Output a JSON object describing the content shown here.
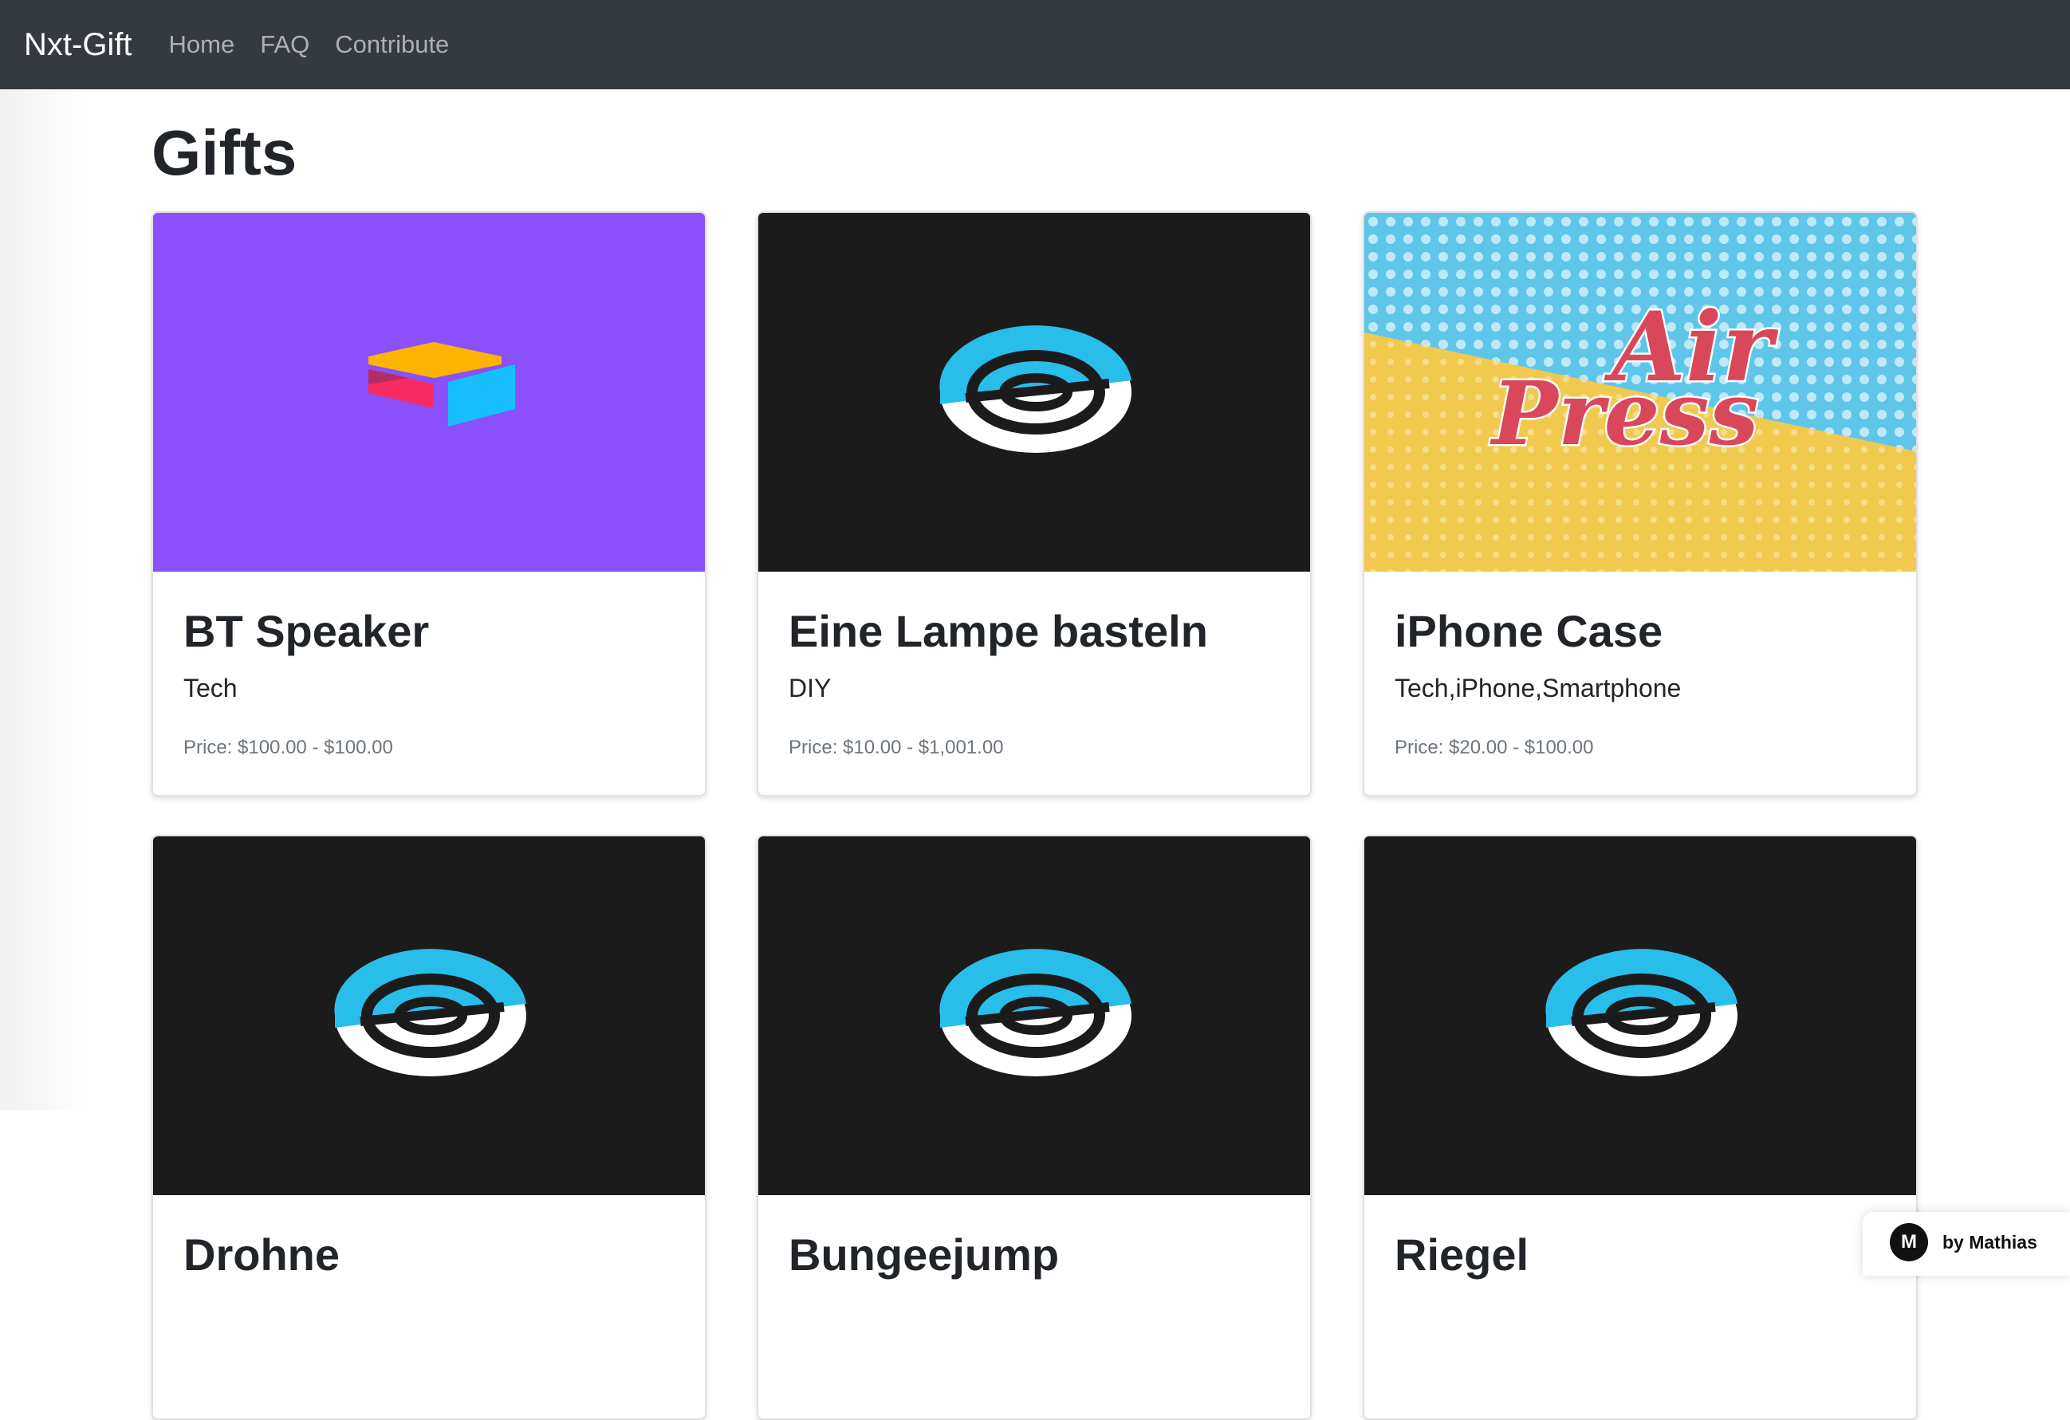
{
  "navbar": {
    "brand": "Nxt-Gift",
    "links": [
      "Home",
      "FAQ",
      "Contribute"
    ]
  },
  "page": {
    "title": "Gifts"
  },
  "gifts": [
    {
      "title": "BT Speaker",
      "tags": "Tech",
      "price": "Price: $100.00 - $100.00",
      "image": "airtable-logo"
    },
    {
      "title": "Eine Lampe basteln",
      "tags": "DIY",
      "price": "Price: $10.00 - $1,001.00",
      "image": "swirl-logo"
    },
    {
      "title": "iPhone Case",
      "tags": "Tech,iPhone,Smartphone",
      "price": "Price: $20.00 - $100.00",
      "image": "airpress-logo",
      "image_text": [
        "Air",
        "Press"
      ]
    },
    {
      "title": "Drohne",
      "image": "swirl-logo"
    },
    {
      "title": "Bungeejump",
      "image": "swirl-logo"
    },
    {
      "title": "Riegel",
      "image": "swirl-logo"
    }
  ],
  "badge": {
    "text": "by Mathias",
    "avatar_text": "M"
  },
  "colors": {
    "navbar": "#343a40",
    "airtable_purple": "#8b4ffb",
    "dark_tile": "#1b1b1c",
    "swirl_blue": "#29bdea",
    "airpress_blue": "#5fc6ea",
    "airpress_yellow": "#f2c94f",
    "airpress_red": "#d9475b"
  }
}
